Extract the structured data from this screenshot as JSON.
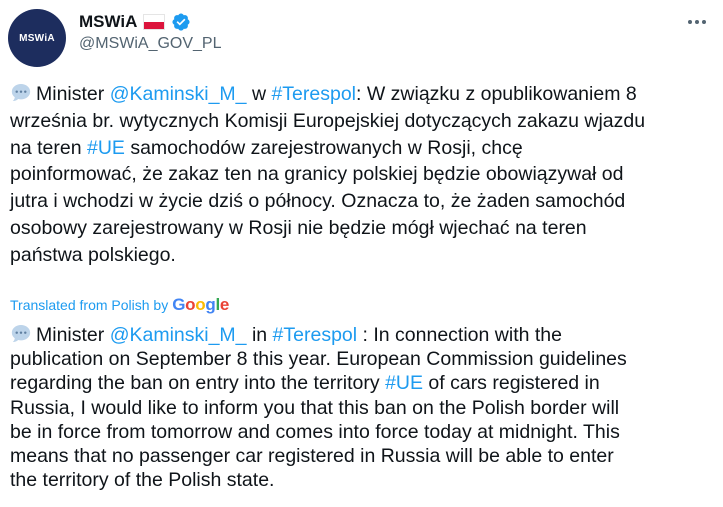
{
  "account": {
    "name": "MSWiA",
    "handle": "@MSWiA_GOV_PL",
    "avatar_text": "MSWiA",
    "flag_icon": "flag-poland-icon",
    "verified_icon": "verified-badge-icon",
    "more_icon": "more-options-icon"
  },
  "original": {
    "lines": [
      [
        {
          "t": "Minister "
        },
        {
          "t": "@Kaminski_M_",
          "link": true
        },
        {
          "t": " w "
        },
        {
          "t": "#Terespol",
          "link": true
        },
        {
          "t": ": W związku z opublikowaniem 8"
        }
      ],
      [
        {
          "t": "września br. wytycznych Komisji Europejskiej dotyczących zakazu wjazdu"
        }
      ],
      [
        {
          "t": "na teren "
        },
        {
          "t": "#UE",
          "link": true
        },
        {
          "t": " samochodów zarejestrowanych w Rosji, chcę"
        }
      ],
      [
        {
          "t": "poinformować, że zakaz ten na granicy polskiej będzie obowiązywał od"
        }
      ],
      [
        {
          "t": "jutra i wchodzi w życie dziś o północy. Oznacza to, że żaden samochód"
        }
      ],
      [
        {
          "t": "osobowy zarejestrowany w Rosji nie będzie mógł wjechać na teren"
        }
      ],
      [
        {
          "t": "państwa polskiego."
        }
      ]
    ]
  },
  "translation_label": {
    "text": "Translated from Polish by",
    "provider": "Google"
  },
  "translated": {
    "lines": [
      [
        {
          "t": "Minister "
        },
        {
          "t": "@Kaminski_M_",
          "link": true
        },
        {
          "t": " in "
        },
        {
          "t": "#Terespol",
          "link": true
        },
        {
          "t": " : In connection with the"
        }
      ],
      [
        {
          "t": "publication on September 8 this year. European Commission guidelines"
        }
      ],
      [
        {
          "t": "regarding the ban on entry into the territory "
        },
        {
          "t": "#UE",
          "link": true
        },
        {
          "t": " of cars registered in"
        }
      ],
      [
        {
          "t": "Russia, I would like to inform you that this ban on the Polish border will"
        }
      ],
      [
        {
          "t": "be in force from tomorrow and comes into force today at midnight. This"
        }
      ],
      [
        {
          "t": "means that no passenger car registered in Russia will be able to enter"
        }
      ],
      [
        {
          "t": "the territory of the Polish state."
        }
      ]
    ]
  },
  "colors": {
    "link": "#1d9bf0",
    "text": "#0f1419",
    "secondary": "#536471",
    "avatar_bg": "#1d2d5e"
  }
}
